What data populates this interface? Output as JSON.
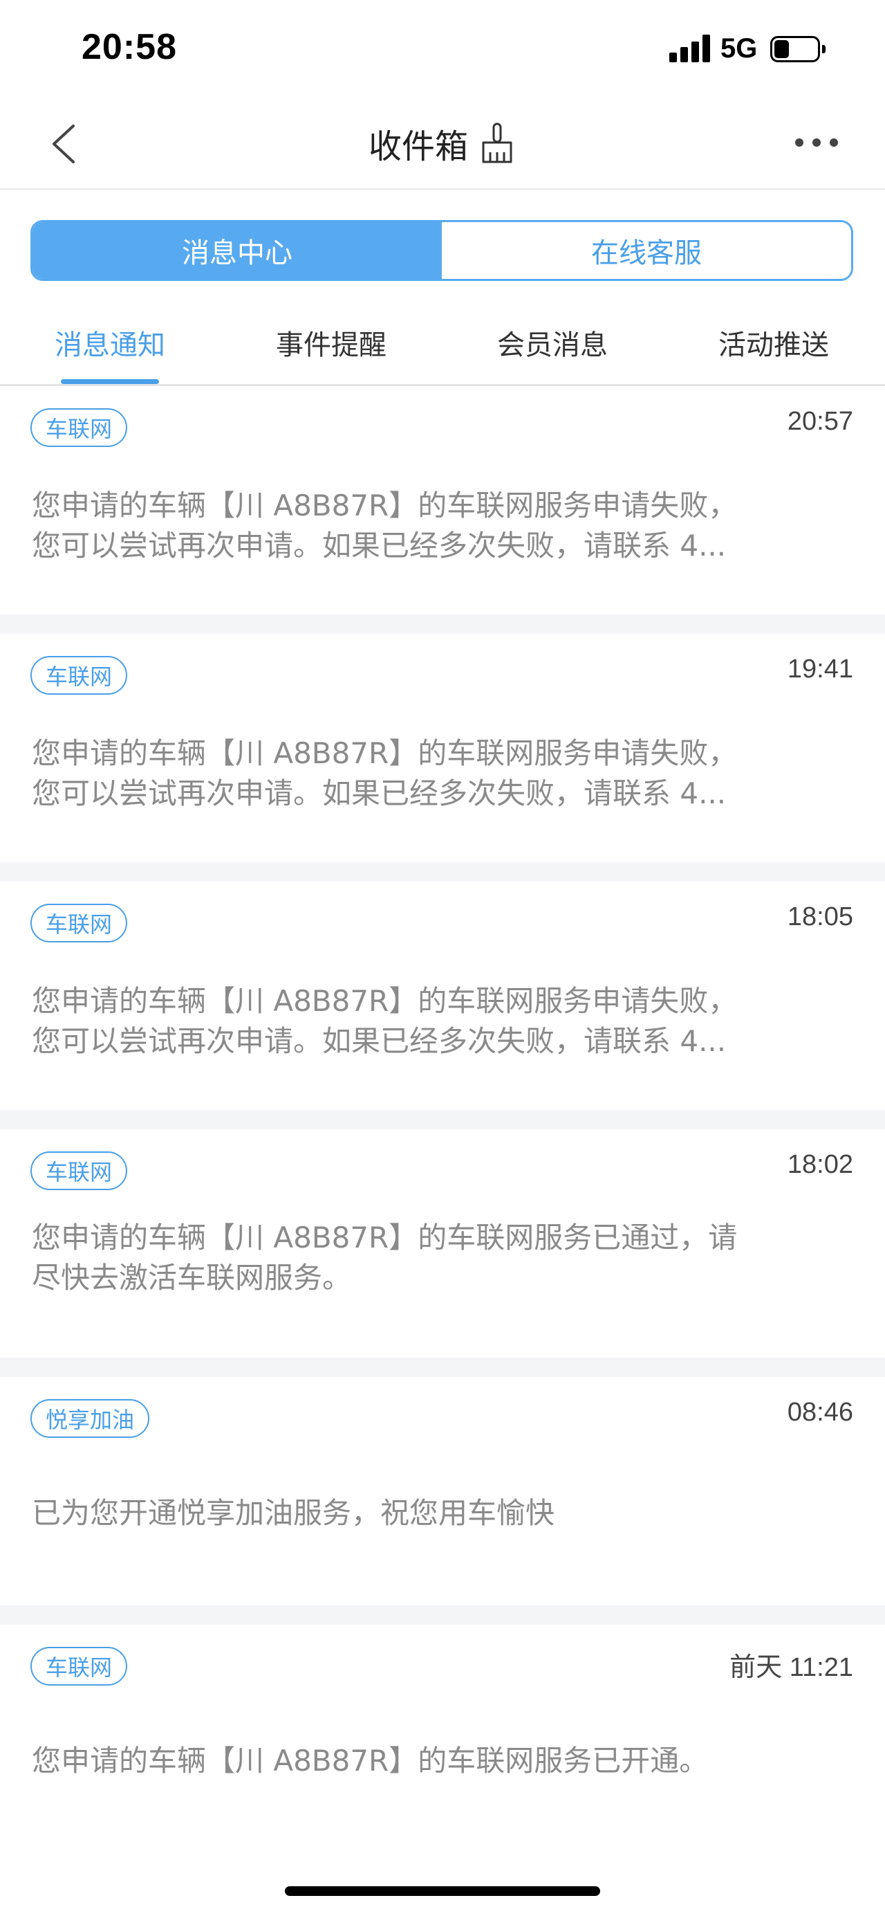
{
  "status_bar": {
    "time": "20:58",
    "network": "5G",
    "battery_level": 0.35
  },
  "nav": {
    "title": "收件箱",
    "back_icon": "chevron-left-icon",
    "clean_icon": "broom-icon",
    "more_icon": "more-dots-icon"
  },
  "segment": {
    "left": "消息中心",
    "right": "在线客服",
    "selected": "消息中心"
  },
  "tabs": [
    {
      "label": "消息通知",
      "active": true
    },
    {
      "label": "事件提醒",
      "active": false
    },
    {
      "label": "会员消息",
      "active": false
    },
    {
      "label": "活动推送",
      "active": false
    }
  ],
  "messages": [
    {
      "tag": "车联网",
      "time": "20:57",
      "lines": [
        "您申请的车辆【川 A8B87R】的车联网服务申请失败，",
        "您可以尝试再次申请。如果已经多次失败，请联系 4..."
      ]
    },
    {
      "tag": "车联网",
      "time": "19:41",
      "lines": [
        "您申请的车辆【川 A8B87R】的车联网服务申请失败，",
        "您可以尝试再次申请。如果已经多次失败，请联系 4..."
      ]
    },
    {
      "tag": "车联网",
      "time": "18:05",
      "lines": [
        "您申请的车辆【川 A8B87R】的车联网服务申请失败，",
        "您可以尝试再次申请。如果已经多次失败，请联系 4..."
      ]
    },
    {
      "tag": "车联网",
      "time": "18:02",
      "lines": [
        "您申请的车辆【川 A8B87R】的车联网服务已通过，请",
        "尽快去激活车联网服务。"
      ]
    },
    {
      "tag": "悦享加油",
      "time": "08:46",
      "lines": [
        "已为您开通悦享加油服务，祝您用车愉快"
      ]
    },
    {
      "tag": "车联网",
      "time": "前天 11:21",
      "lines": [
        "您申请的车辆【川 A8B87R】的车联网服务已开通。"
      ]
    }
  ],
  "colors": {
    "accent": "#4a9fe8",
    "segment_active": "#58aaf0",
    "body_text": "#8a8a8a",
    "divider": "#f4f5f7"
  }
}
